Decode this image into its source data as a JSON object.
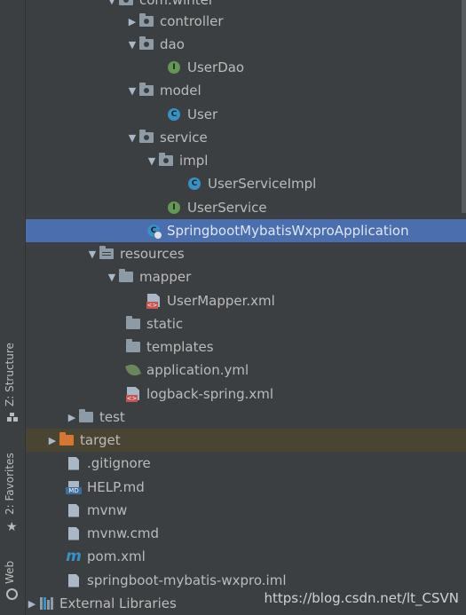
{
  "sidebar": {
    "structure_label": "Z: Structure",
    "favorites_label": "2: Favorites",
    "web_label": "Web"
  },
  "tree": {
    "items": [
      {
        "label": "com.winter",
        "icon": "package-folder-icon",
        "arrow": "expanded"
      },
      {
        "label": "controller",
        "icon": "package-folder-icon",
        "arrow": "collapsed"
      },
      {
        "label": "dao",
        "icon": "package-folder-icon",
        "arrow": "expanded"
      },
      {
        "label": "UserDao",
        "icon": "interface-icon",
        "icon_text": "I"
      },
      {
        "label": "model",
        "icon": "package-folder-icon",
        "arrow": "expanded"
      },
      {
        "label": "User",
        "icon": "class-icon",
        "icon_text": "C"
      },
      {
        "label": "service",
        "icon": "package-folder-icon",
        "arrow": "expanded"
      },
      {
        "label": "impl",
        "icon": "package-folder-icon",
        "arrow": "expanded"
      },
      {
        "label": "UserServiceImpl",
        "icon": "class-icon",
        "icon_text": "C"
      },
      {
        "label": "UserService",
        "icon": "interface-icon",
        "icon_text": "I"
      },
      {
        "label": "SpringbootMybatisWxproApplication",
        "icon": "spring-app-class-icon",
        "icon_text": "C",
        "selected": true
      },
      {
        "label": "resources",
        "icon": "resources-folder-icon",
        "arrow": "expanded"
      },
      {
        "label": "mapper",
        "icon": "folder-icon",
        "arrow": "expanded"
      },
      {
        "label": "UserMapper.xml",
        "icon": "xml-file-icon"
      },
      {
        "label": "static",
        "icon": "folder-icon"
      },
      {
        "label": "templates",
        "icon": "folder-icon"
      },
      {
        "label": "application.yml",
        "icon": "spring-leaf-icon"
      },
      {
        "label": "logback-spring.xml",
        "icon": "xml-file-icon"
      },
      {
        "label": "test",
        "icon": "folder-icon",
        "arrow": "collapsed"
      },
      {
        "label": "target",
        "icon": "excluded-folder-icon",
        "arrow": "collapsed"
      },
      {
        "label": ".gitignore",
        "icon": "text-file-icon"
      },
      {
        "label": "HELP.md",
        "icon": "markdown-file-icon",
        "icon_text": "MD"
      },
      {
        "label": "mvnw",
        "icon": "text-file-icon"
      },
      {
        "label": "mvnw.cmd",
        "icon": "text-file-icon"
      },
      {
        "label": "pom.xml",
        "icon": "maven-icon",
        "icon_text": "m"
      },
      {
        "label": "springboot-mybatis-wxpro.iml",
        "icon": "module-file-icon"
      },
      {
        "label": "External Libraries",
        "icon": "libraries-icon",
        "arrow": "collapsed"
      }
    ]
  },
  "watermark": "https://blog.csdn.net/lt_CSVN",
  "colors": {
    "background": "#3c3f41",
    "selection": "#4b6eaf",
    "target_row": "#4a4433"
  }
}
